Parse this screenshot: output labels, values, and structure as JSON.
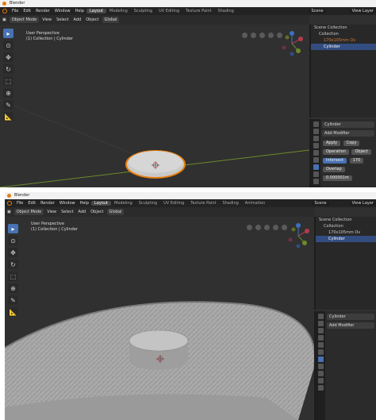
{
  "windows": [
    {
      "title": "Blender",
      "menu": [
        "File",
        "Edit",
        "Render",
        "Window",
        "Help"
      ],
      "tabs": [
        "Layout",
        "Modeling",
        "Sculpting",
        "UV Editing",
        "Texture Paint",
        "Shading"
      ],
      "active_tab": "Layout",
      "scene": "Scene",
      "view_layer": "View Layer",
      "header": {
        "mode": "Object Mode",
        "items": [
          "View",
          "Select",
          "Add",
          "Object"
        ],
        "transform": "Global"
      },
      "viewport": {
        "line1": "User Perspective",
        "line2": "(1) Collection | Cylinder"
      },
      "outliner": {
        "rows": [
          {
            "label": "Scene Collection",
            "sel": false,
            "dim": false
          },
          {
            "label": "Collection",
            "sel": false,
            "dim": false
          },
          {
            "label": "170x105mm Ov",
            "sel": false,
            "dim": true
          },
          {
            "label": "Cylinder",
            "sel": true,
            "dim": false
          }
        ]
      },
      "properties": {
        "object": "Cylinder",
        "add_modifier": "Add Modifier",
        "apply": "Apply",
        "copy": "Copy",
        "operation": "Operation",
        "object_label": "Object",
        "intersect": "Intersect",
        "value": "170",
        "overlap": "Overlap",
        "overlap_value": "0.000001m"
      }
    },
    {
      "title": "Blender",
      "menu": [
        "File",
        "Edit",
        "Render",
        "Window",
        "Help"
      ],
      "tabs": [
        "Layout",
        "Modeling",
        "Sculpting",
        "UV Editing",
        "Texture Paint",
        "Shading",
        "Animation"
      ],
      "active_tab": "Layout",
      "scene": "Scene",
      "view_layer": "View Layer",
      "header": {
        "mode": "Object Mode",
        "items": [
          "View",
          "Select",
          "Add",
          "Object"
        ],
        "transform": "Global"
      },
      "viewport": {
        "line1": "User Perspective",
        "line2": "(1) Collection | Cylinder"
      },
      "outliner": {
        "rows": [
          {
            "label": "Scene Collection",
            "sel": false,
            "dim": false
          },
          {
            "label": "Collection",
            "sel": false,
            "dim": false
          },
          {
            "label": "170x105mm Ov",
            "sel": false,
            "dim": false
          },
          {
            "label": "Cylinder",
            "sel": true,
            "dim": false
          }
        ]
      },
      "properties": {
        "object": "Cylinder",
        "add_modifier": "Add Modifier"
      }
    }
  ],
  "colors": {
    "accent": "#4772b3",
    "selection_orange": "#e87d0d",
    "x_axis": "#9b3340",
    "y_axis": "#6d8a2a"
  }
}
